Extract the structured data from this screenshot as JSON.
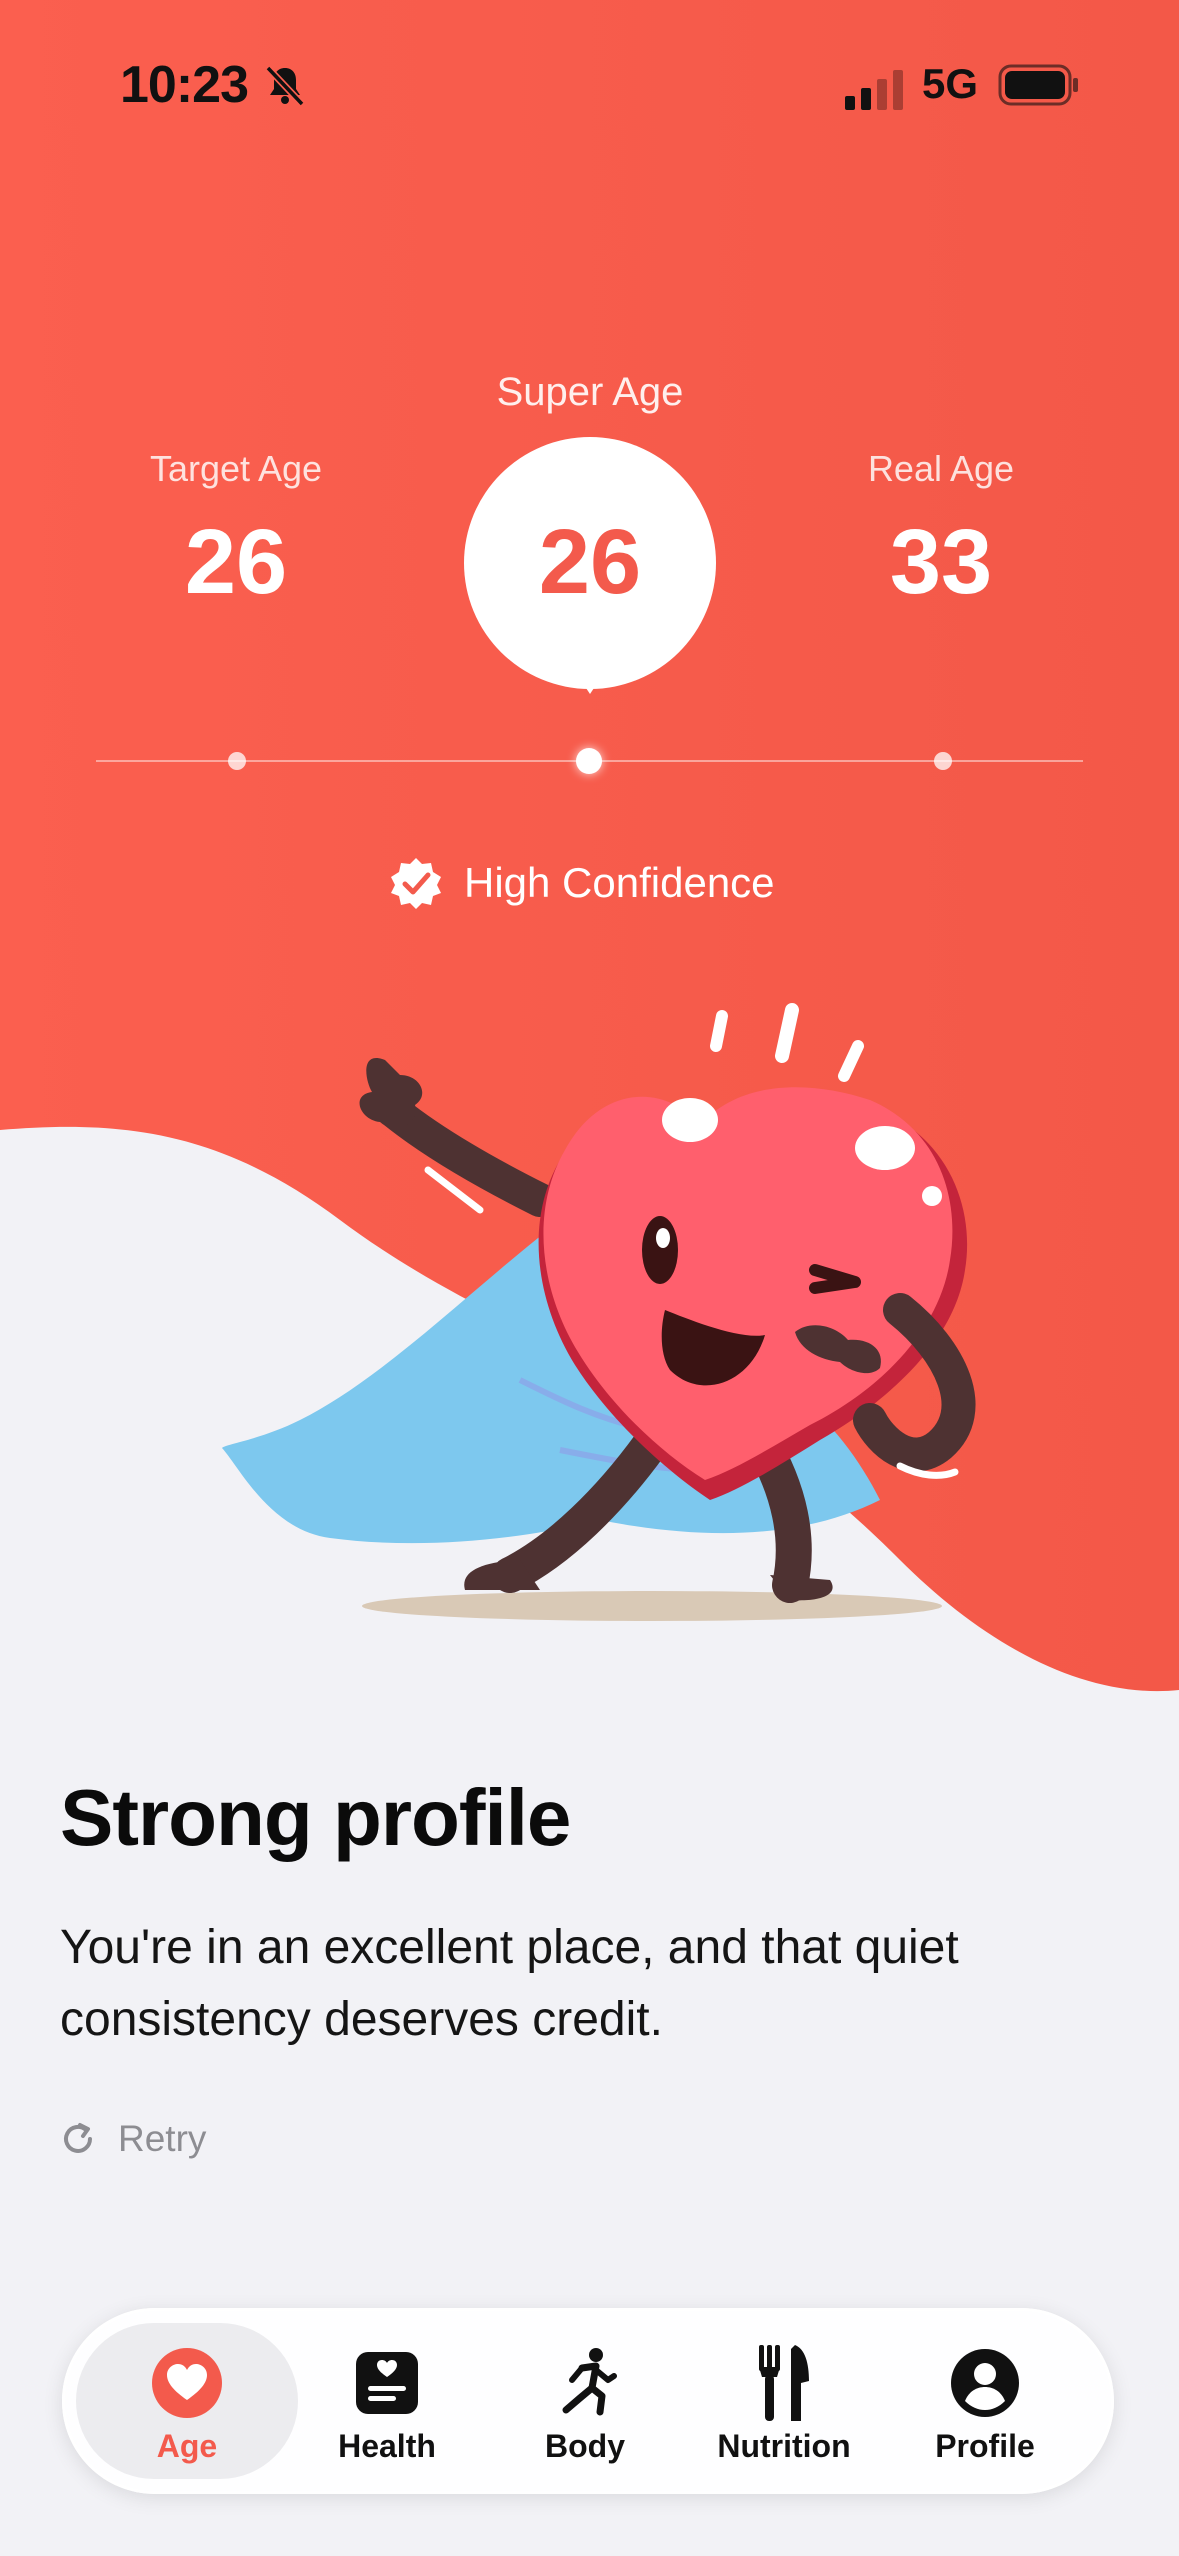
{
  "status_bar": {
    "time": "10:23",
    "network": "5G"
  },
  "ages": {
    "target_label": "Target Age",
    "target_value": "26",
    "super_label": "Super Age",
    "super_value": "26",
    "real_label": "Real Age",
    "real_value": "33"
  },
  "confidence": {
    "text": "High Confidence"
  },
  "result": {
    "title": "Strong profile",
    "description": "You're in an excellent place, and that quiet consistency deserves credit."
  },
  "retry": {
    "label": "Retry"
  },
  "tabs": [
    {
      "label": "Age",
      "icon": "heart-icon",
      "active": true
    },
    {
      "label": "Health",
      "icon": "health-record-icon",
      "active": false
    },
    {
      "label": "Body",
      "icon": "running-figure-icon",
      "active": false
    },
    {
      "label": "Nutrition",
      "icon": "fork-knife-icon",
      "active": false
    },
    {
      "label": "Profile",
      "icon": "person-circle-icon",
      "active": false
    }
  ],
  "colors": {
    "accent": "#F35A4C",
    "background": "#F2F2F6",
    "heart": "#FF5F6D",
    "cape": "#7DC8EE"
  }
}
